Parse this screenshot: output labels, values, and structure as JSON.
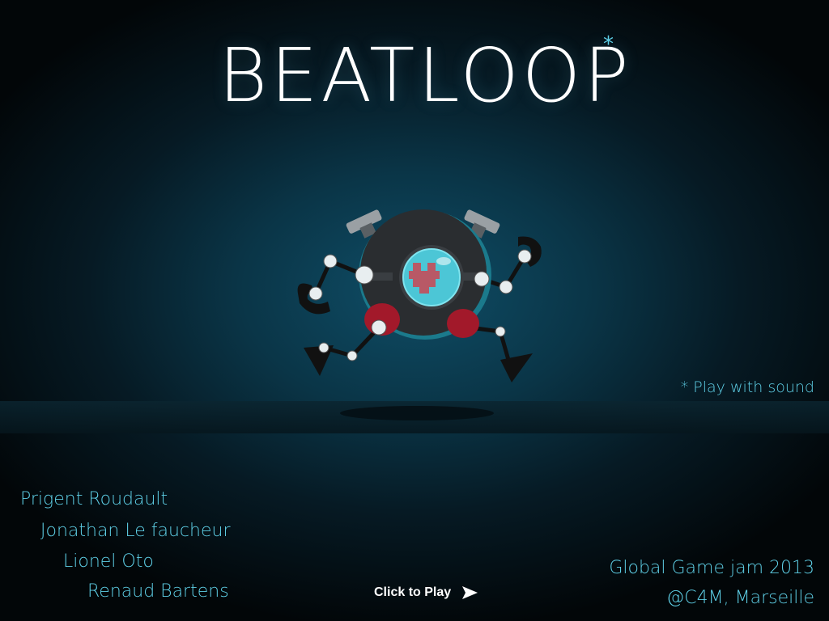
{
  "game": {
    "title": "BEATLOOP",
    "title_mark": "*"
  },
  "note": {
    "sound_hint": "* Play with sound"
  },
  "credits": [
    "Prigent Roudault",
    "Jonathan Le faucheur",
    "Lionel Oto",
    "Renaud Bartens"
  ],
  "event": {
    "line1": "Global Game jam 2013",
    "line2": "@C4M, Marseille"
  },
  "play": {
    "label": "Click to Play",
    "icon": "play-arrow-icon"
  },
  "colors": {
    "accent": "#5ecfe6",
    "text": "#ffffff",
    "background": "#0a3547"
  }
}
